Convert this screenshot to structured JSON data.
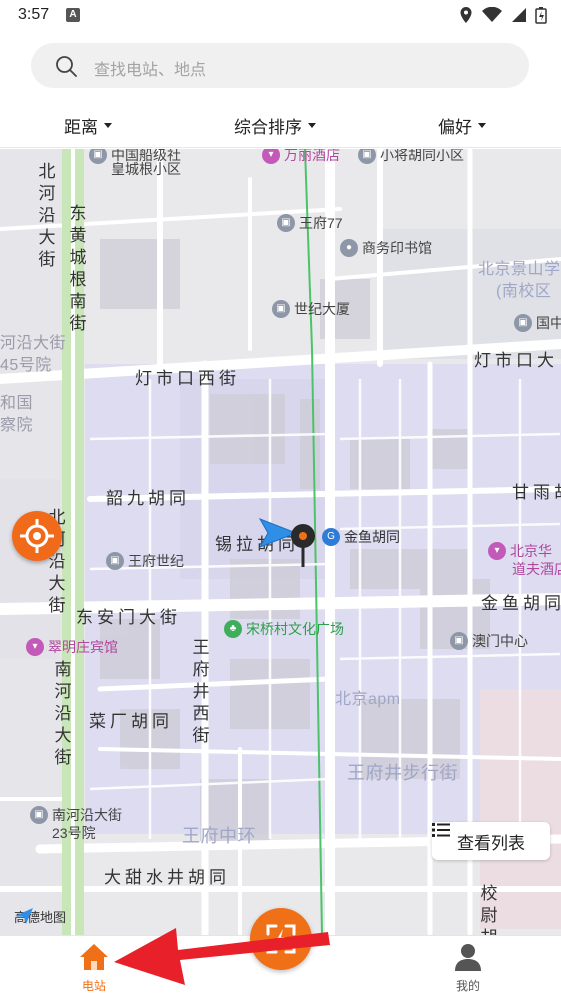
{
  "status_bar": {
    "time": "3:57",
    "app_badge": "A"
  },
  "search": {
    "placeholder": "查找电站、地点"
  },
  "filters": [
    {
      "label": "距离"
    },
    {
      "label": "综合排序"
    },
    {
      "label": "偏好"
    }
  ],
  "map": {
    "roads": {
      "dengshikou": "灯市口西街",
      "dengshikou_east": "灯市口大",
      "shaojiu": "韶九胡同",
      "xilahutong": "锡拉胡同",
      "jinyu": "金鱼胡同",
      "jinyu_poi": "金鱼胡同",
      "donganmen": "东安门大街",
      "caichang": "菜厂胡同",
      "datianshui": "大甜水井胡同",
      "ganyu": "甘雨胡",
      "beiheyan": "北河沿大街",
      "donghuangcheng": "东黄城根南街",
      "beiheyan2": "北河沿大街",
      "nanheyan": "南河沿大街",
      "wangfujing_west": "王府井西街",
      "qiao": "校尉胡"
    },
    "areas": {
      "wangfujing_walk": "王府井步行街",
      "wangfu_ring": "王府中环",
      "beijing_apm": "北京apm",
      "beijing_jingshan_1": "北京景山学",
      "beijing_jingshan_2": "(南校区",
      "beiheyan_45": "河沿大街",
      "beiheyan_45b": "45号院",
      "heguo": "和国",
      "chayuan": "察院"
    },
    "pois": {
      "zhongguo": "中国船级社",
      "huangcheng": "皇城根小区",
      "wanli": "万丽酒店",
      "xiaoqiao": "小将胡同小区",
      "wangfu77": "王府77",
      "shangwu": "商务印书馆",
      "shiji": "世纪大厦",
      "guomao": "国中",
      "wangfushiji": "王府世纪",
      "huafu": "北京华",
      "huafu2": "道夫酒店",
      "cuiming": "翠明庄宾馆",
      "songqiao": "宋桥村文化广场",
      "aomen": "澳门中心",
      "nanheyan23": "南河沿大街",
      "nanheyan23b": "23号院"
    }
  },
  "list_button": {
    "label": "查看列表"
  },
  "amap_logo": "高德地图",
  "bottom_nav": {
    "station": "电站",
    "mine": "我的"
  },
  "colors": {
    "accent": "#f07018",
    "nav_active": "#f07018",
    "arrow": "#e8202a",
    "route_green": "#4cc36a"
  }
}
